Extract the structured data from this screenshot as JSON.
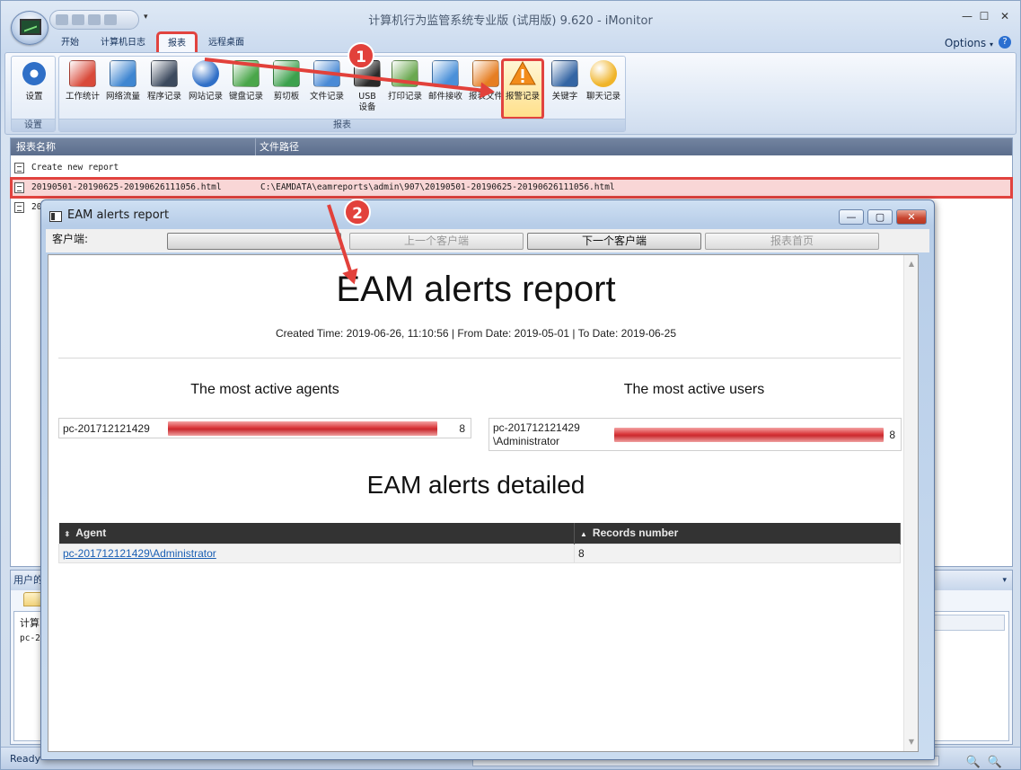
{
  "app": {
    "title": "计算机行为监管系统专业版 (试用版) 9.620 - iMonitor",
    "tabs": [
      "开始",
      "计算机日志",
      "报表",
      "远程桌面"
    ],
    "options_label": "Options",
    "options_caret": "▾",
    "help_glyph": "?",
    "qat_dropdown_glyph": "▾",
    "window_controls": {
      "minimize": "—",
      "maximize": "☐",
      "close": "✕"
    }
  },
  "ribbon": {
    "settings_group": {
      "label": "设置",
      "button": "设置"
    },
    "report_group": {
      "label": "报表",
      "buttons": [
        {
          "label": "工作统计",
          "icon": "people-chart-icon",
          "color": "#d94a3a"
        },
        {
          "label": "网络流量",
          "icon": "network-monitors-icon",
          "color": "#3f86d1"
        },
        {
          "label": "程序记录",
          "icon": "console-window-icon",
          "color": "#3c4a5e"
        },
        {
          "label": "网站记录",
          "icon": "globe-icon",
          "color": "#2f6fc7"
        },
        {
          "label": "键盘记录",
          "icon": "keyboard-grid-icon",
          "color": "#4aa64a"
        },
        {
          "label": "剪切板",
          "icon": "clipboard-arrow-icon",
          "color": "#3ca14d"
        },
        {
          "label": "文件记录",
          "icon": "file-doc-icon",
          "color": "#4a8ad6"
        },
        {
          "label": "USB\n设备",
          "icon": "usb-drive-icon",
          "color": "#2a2a2a"
        },
        {
          "label": "打印记录",
          "icon": "printer-icon",
          "color": "#6aa84f"
        },
        {
          "label": "邮件接收",
          "icon": "mail-arrow-icon",
          "color": "#4a90d9"
        },
        {
          "label": "报表文件",
          "icon": "windows-flag-icon",
          "color": "#e67e22"
        },
        {
          "label": "报警记录",
          "icon": "warning-triangle-icon",
          "color": "#f28c1a"
        },
        {
          "label": "关键字",
          "icon": "document-info-icon",
          "color": "#3465a4"
        },
        {
          "label": "聊天记录",
          "icon": "chat-bubbles-icon",
          "color": "#f0b429"
        }
      ]
    }
  },
  "report_list": {
    "columns": [
      "报表名称",
      "文件路径"
    ],
    "rows": [
      {
        "name": "Create new report",
        "path": ""
      },
      {
        "name": "20190501-20190625-20190626111056.html",
        "path": "C:\\EAMDATA\\eamreports\\admin\\907\\20190501-20190625-20190626111056.html"
      },
      {
        "name": "20",
        "path": ""
      }
    ]
  },
  "bottom_panel": {
    "title": "用户的",
    "col_header": "计算",
    "cell": "pc-2",
    "arrow_glyph": "▾"
  },
  "status": {
    "text": "Ready",
    "zoom_glyphs": "🔍🔍"
  },
  "annotations": {
    "badge1": "1",
    "badge2": "2"
  },
  "popup": {
    "title": "EAM alerts report",
    "client_label": "客户端:",
    "buttons": [
      {
        "label": "",
        "enabled": true
      },
      {
        "label": "上一个客户端",
        "enabled": false
      },
      {
        "label": "下一个客户端",
        "enabled": true
      },
      {
        "label": "报表首页",
        "enabled": false
      }
    ],
    "window_controls": {
      "minimize": "—",
      "maximize": "▢",
      "close": "✕"
    },
    "scroll_glyphs": {
      "up": "▲",
      "down": "▼"
    }
  },
  "report": {
    "title": "EAM alerts report",
    "meta": "Created Time: 2019-06-26, 11:10:56 | From Date: 2019-05-01 | To Date: 2019-06-25",
    "agents": {
      "title": "The most active agents",
      "items": [
        {
          "label": "pc-201712121429",
          "value": 8,
          "fraction": 1.0
        }
      ]
    },
    "users": {
      "title": "The most active users",
      "items": [
        {
          "label_line1": "pc-201712121429",
          "label_line2": "\\Administrator",
          "value": 8,
          "fraction": 1.0
        }
      ]
    },
    "detailed_title": "EAM alerts detailed",
    "table": {
      "headers": [
        "Agent",
        "Records number"
      ],
      "sort_glyphs": [
        "⬍",
        "▲"
      ],
      "rows": [
        {
          "agent": "pc-201712121429\\Administrator",
          "records": "8"
        }
      ]
    }
  }
}
